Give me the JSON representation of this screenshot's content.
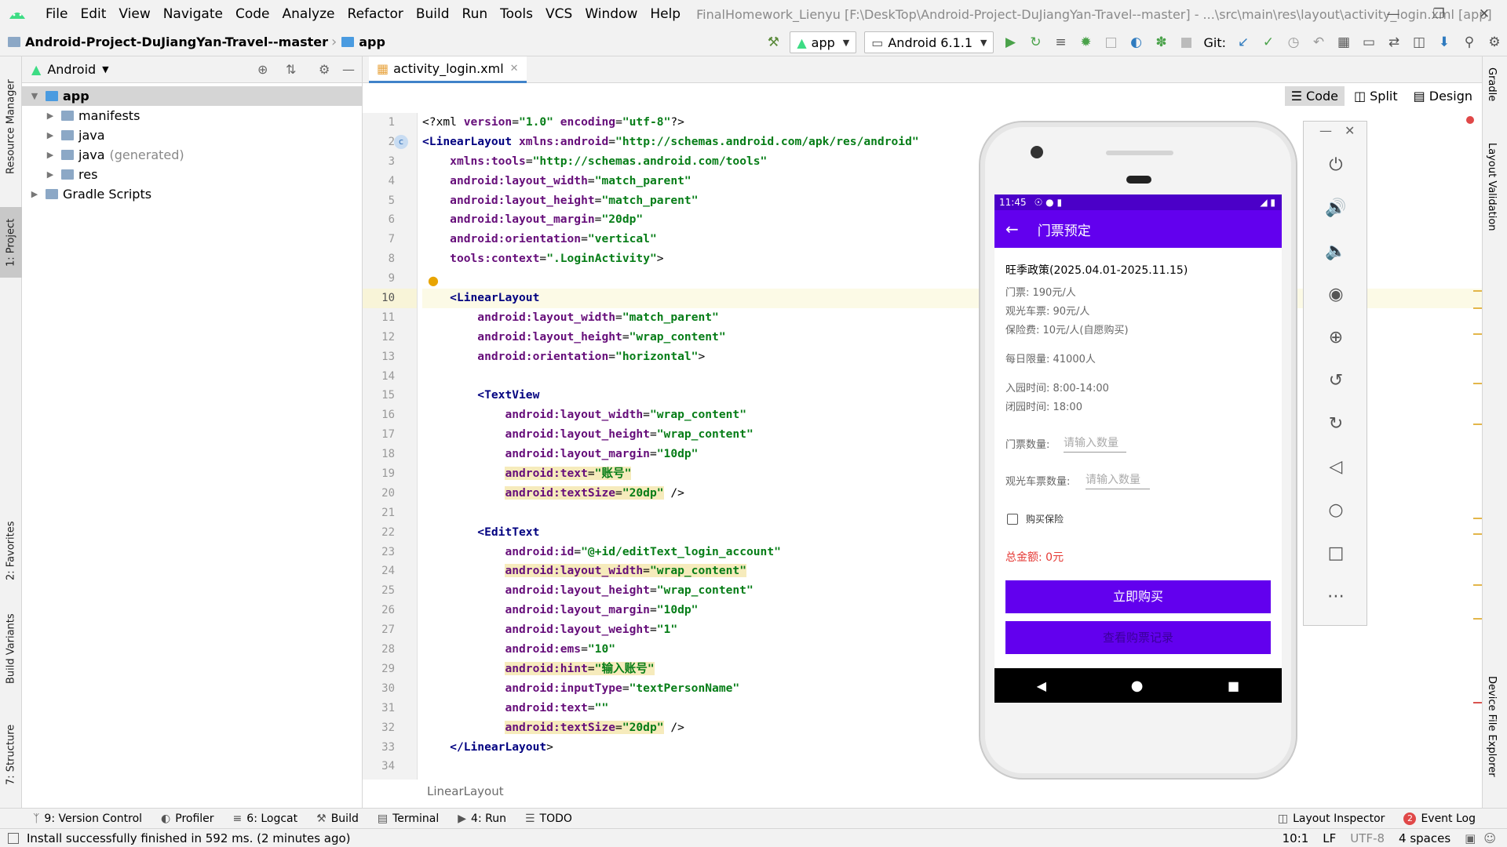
{
  "menu": {
    "items": [
      "File",
      "Edit",
      "View",
      "Navigate",
      "Code",
      "Analyze",
      "Refactor",
      "Build",
      "Run",
      "Tools",
      "VCS",
      "Window",
      "Help"
    ],
    "window_title": "FinalHomework_Lienyu [F:\\DeskTop\\Android-Project-DuJiangYan-Travel--master] - ...\\src\\main\\res\\layout\\activity_login.xml [app]"
  },
  "nav": {
    "project": "Android-Project-DuJiangYan-Travel--master",
    "module": "app",
    "run_config": "app",
    "device": "Android 6.1.1",
    "git_label": "Git:"
  },
  "left_stripe": {
    "resource_manager": "Resource Manager",
    "project": "1: Project",
    "favorites": "2: Favorites",
    "build_variants": "Build Variants",
    "structure": "7: Structure"
  },
  "project_panel": {
    "view": "Android",
    "tree": [
      {
        "label": "app",
        "indent": 0
      },
      {
        "label": "manifests",
        "indent": 1
      },
      {
        "label": "java",
        "indent": 1
      },
      {
        "label": "java",
        "suffix": "(generated)",
        "indent": 1
      },
      {
        "label": "res",
        "indent": 1
      },
      {
        "label": "Gradle Scripts",
        "indent": 0
      }
    ]
  },
  "editor": {
    "tab": "activity_login.xml",
    "view_modes": [
      "Code",
      "Split",
      "Design"
    ],
    "breadcrumb": "LinearLayout",
    "line_numbers": [
      "1",
      "2",
      "3",
      "4",
      "5",
      "6",
      "7",
      "8",
      "9",
      "10",
      "11",
      "12",
      "13",
      "14",
      "15",
      "16",
      "17",
      "18",
      "19",
      "20",
      "21",
      "22",
      "23",
      "24",
      "25",
      "26",
      "27",
      "28",
      "29",
      "30",
      "31",
      "32",
      "33",
      "34"
    ],
    "current_line": 10,
    "lines": [
      [
        {
          "c": "p",
          "t": "<?xml "
        },
        {
          "c": "a",
          "t": "version"
        },
        {
          "c": "p",
          "t": "="
        },
        {
          "c": "v",
          "t": "\"1.0\""
        },
        {
          "c": "p",
          "t": " "
        },
        {
          "c": "a",
          "t": "encoding"
        },
        {
          "c": "p",
          "t": "="
        },
        {
          "c": "v",
          "t": "\"utf-8\""
        },
        {
          "c": "p",
          "t": "?>"
        }
      ],
      [
        {
          "c": "t",
          "t": "<LinearLayout "
        },
        {
          "c": "a",
          "t": "xmlns:android"
        },
        {
          "c": "p",
          "t": "="
        },
        {
          "c": "v",
          "t": "\"http://schemas.android.com/apk/res/android\""
        }
      ],
      [
        {
          "c": "p",
          "t": "    "
        },
        {
          "c": "a",
          "t": "xmlns:tools"
        },
        {
          "c": "p",
          "t": "="
        },
        {
          "c": "v",
          "t": "\"http://schemas.android.com/tools\""
        }
      ],
      [
        {
          "c": "p",
          "t": "    "
        },
        {
          "c": "a",
          "t": "android:layout_width"
        },
        {
          "c": "p",
          "t": "="
        },
        {
          "c": "v",
          "t": "\"match_parent\""
        }
      ],
      [
        {
          "c": "p",
          "t": "    "
        },
        {
          "c": "a",
          "t": "android:layout_height"
        },
        {
          "c": "p",
          "t": "="
        },
        {
          "c": "v",
          "t": "\"match_parent\""
        }
      ],
      [
        {
          "c": "p",
          "t": "    "
        },
        {
          "c": "a",
          "t": "android:layout_margin"
        },
        {
          "c": "p",
          "t": "="
        },
        {
          "c": "v",
          "t": "\"20dp\""
        }
      ],
      [
        {
          "c": "p",
          "t": "    "
        },
        {
          "c": "a",
          "t": "android:orientation"
        },
        {
          "c": "p",
          "t": "="
        },
        {
          "c": "v",
          "t": "\"vertical\""
        }
      ],
      [
        {
          "c": "p",
          "t": "    "
        },
        {
          "c": "a",
          "t": "tools:context"
        },
        {
          "c": "p",
          "t": "="
        },
        {
          "c": "v",
          "t": "\".LoginActivity\""
        },
        {
          "c": "p",
          "t": ">"
        }
      ],
      [],
      [
        {
          "c": "p",
          "t": "    "
        },
        {
          "c": "t",
          "t": "<LinearLayout"
        }
      ],
      [
        {
          "c": "p",
          "t": "        "
        },
        {
          "c": "a",
          "t": "android:layout_width"
        },
        {
          "c": "p",
          "t": "="
        },
        {
          "c": "v",
          "t": "\"match_parent\""
        }
      ],
      [
        {
          "c": "p",
          "t": "        "
        },
        {
          "c": "a",
          "t": "android:layout_height"
        },
        {
          "c": "p",
          "t": "="
        },
        {
          "c": "v",
          "t": "\"wrap_content\""
        }
      ],
      [
        {
          "c": "p",
          "t": "        "
        },
        {
          "c": "a",
          "t": "android:orientation"
        },
        {
          "c": "p",
          "t": "="
        },
        {
          "c": "v",
          "t": "\"horizontal\""
        },
        {
          "c": "p",
          "t": ">"
        }
      ],
      [],
      [
        {
          "c": "p",
          "t": "        "
        },
        {
          "c": "t",
          "t": "<TextView"
        }
      ],
      [
        {
          "c": "p",
          "t": "            "
        },
        {
          "c": "a",
          "t": "android:layout_width"
        },
        {
          "c": "p",
          "t": "="
        },
        {
          "c": "v",
          "t": "\"wrap_content\""
        }
      ],
      [
        {
          "c": "p",
          "t": "            "
        },
        {
          "c": "a",
          "t": "android:layout_height"
        },
        {
          "c": "p",
          "t": "="
        },
        {
          "c": "v",
          "t": "\"wrap_content\""
        }
      ],
      [
        {
          "c": "p",
          "t": "            "
        },
        {
          "c": "a",
          "t": "android:layout_margin"
        },
        {
          "c": "p",
          "t": "="
        },
        {
          "c": "v",
          "t": "\"10dp\""
        }
      ],
      [
        {
          "c": "p",
          "t": "            "
        },
        {
          "c": "a hl",
          "t": "android:text"
        },
        {
          "c": "p hl",
          "t": "="
        },
        {
          "c": "v hl",
          "t": "\"账号\""
        }
      ],
      [
        {
          "c": "p",
          "t": "            "
        },
        {
          "c": "a hl",
          "t": "android:textSize"
        },
        {
          "c": "p hl",
          "t": "="
        },
        {
          "c": "v hl",
          "t": "\"20dp\""
        },
        {
          "c": "p",
          "t": " />"
        }
      ],
      [],
      [
        {
          "c": "p",
          "t": "        "
        },
        {
          "c": "t",
          "t": "<EditText"
        }
      ],
      [
        {
          "c": "p",
          "t": "            "
        },
        {
          "c": "a",
          "t": "android:id"
        },
        {
          "c": "p",
          "t": "="
        },
        {
          "c": "v",
          "t": "\"@+id/editText_login_account\""
        }
      ],
      [
        {
          "c": "p",
          "t": "            "
        },
        {
          "c": "a hl",
          "t": "android:layout_width"
        },
        {
          "c": "p hl",
          "t": "="
        },
        {
          "c": "v hl",
          "t": "\"wrap_content\""
        }
      ],
      [
        {
          "c": "p",
          "t": "            "
        },
        {
          "c": "a",
          "t": "android:layout_height"
        },
        {
          "c": "p",
          "t": "="
        },
        {
          "c": "v",
          "t": "\"wrap_content\""
        }
      ],
      [
        {
          "c": "p",
          "t": "            "
        },
        {
          "c": "a",
          "t": "android:layout_margin"
        },
        {
          "c": "p",
          "t": "="
        },
        {
          "c": "v",
          "t": "\"10dp\""
        }
      ],
      [
        {
          "c": "p",
          "t": "            "
        },
        {
          "c": "a",
          "t": "android:layout_weight"
        },
        {
          "c": "p",
          "t": "="
        },
        {
          "c": "v",
          "t": "\"1\""
        }
      ],
      [
        {
          "c": "p",
          "t": "            "
        },
        {
          "c": "a",
          "t": "android:ems"
        },
        {
          "c": "p",
          "t": "="
        },
        {
          "c": "v",
          "t": "\"10\""
        }
      ],
      [
        {
          "c": "p",
          "t": "            "
        },
        {
          "c": "a hl",
          "t": "android:hint"
        },
        {
          "c": "p hl",
          "t": "="
        },
        {
          "c": "v hl",
          "t": "\"输入账号\""
        }
      ],
      [
        {
          "c": "p",
          "t": "            "
        },
        {
          "c": "a",
          "t": "android:inputType"
        },
        {
          "c": "p",
          "t": "="
        },
        {
          "c": "v",
          "t": "\"textPersonName\""
        }
      ],
      [
        {
          "c": "p",
          "t": "            "
        },
        {
          "c": "a",
          "t": "android:text"
        },
        {
          "c": "p",
          "t": "="
        },
        {
          "c": "v",
          "t": "\"\""
        }
      ],
      [
        {
          "c": "p",
          "t": "            "
        },
        {
          "c": "a hl",
          "t": "android:textSize"
        },
        {
          "c": "p hl",
          "t": "="
        },
        {
          "c": "v hl",
          "t": "\"20dp\""
        },
        {
          "c": "p",
          "t": " />"
        }
      ],
      [
        {
          "c": "p",
          "t": "    "
        },
        {
          "c": "t",
          "t": "</LinearLayout"
        },
        {
          "c": "p",
          "t": ">"
        }
      ],
      []
    ]
  },
  "phone": {
    "time": "11:45",
    "app_title": "门票预定",
    "policy": "旺季政策(2025.04.01-2025.11.15)",
    "ticket_price": "门票: 190元/人",
    "bus_price": "观光车票: 90元/人",
    "insurance_price": "保险费: 10元/人(自愿购买)",
    "daily_limit": "每日限量: 41000人",
    "open_time": "入园时间: 8:00-14:00",
    "close_time": "闭园时间: 18:00",
    "ticket_qty_label": "门票数量:",
    "ticket_qty_hint": "请输入数量",
    "bus_qty_label": "观光车票数量:",
    "bus_qty_hint": "请输入数量",
    "insurance_checkbox": "购买保险",
    "total": "总金额: 0元",
    "buy_button": "立即购买",
    "records_button": "查看购票记录"
  },
  "right_stripe": {
    "gradle": "Gradle",
    "layout_validation": "Layout Validation",
    "device_file_explorer": "Device File Explorer"
  },
  "bottom_tools": {
    "version_control": "9: Version Control",
    "profiler": "Profiler",
    "logcat": "6: Logcat",
    "build": "Build",
    "terminal": "Terminal",
    "run": "4: Run",
    "todo": "TODO",
    "layout_inspector": "Layout Inspector",
    "event_log": "Event Log",
    "event_count": "2"
  },
  "status": {
    "message": "Install successfully finished in 592 ms. (2 minutes ago)",
    "position": "10:1",
    "line_sep": "LF",
    "encoding": "UTF-8",
    "indent": "4 spaces"
  },
  "colors": {
    "accent": "#6200ee",
    "status_bar": "#4b00c8",
    "total_red": "#e53935"
  }
}
